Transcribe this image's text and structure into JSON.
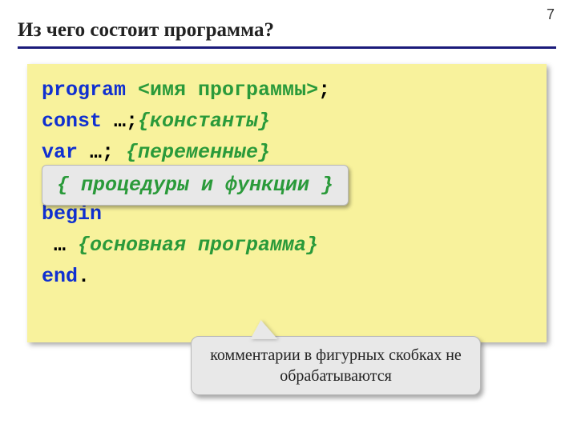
{
  "page_number": "7",
  "title": "Из чего состоит программа?",
  "code": {
    "l1_kw": "program ",
    "l1_ph": "<имя программы>",
    "l1_end": ";",
    "l2_kw": "const ",
    "l2_plain": "…;",
    "l2_comment": "{константы}",
    "l3_kw": "var ",
    "l3_plain": "…; ",
    "l3_comment": "{переменные}",
    "proc_callout": "{ процедуры и функции }",
    "l5_kw": "begin",
    "l6_prefix": " … ",
    "l6_comment": "{основная программа}",
    "l7_kw": "end",
    "l7_dot": "."
  },
  "bottom_callout": "комментарии в фигурных скобках не обрабатываются"
}
